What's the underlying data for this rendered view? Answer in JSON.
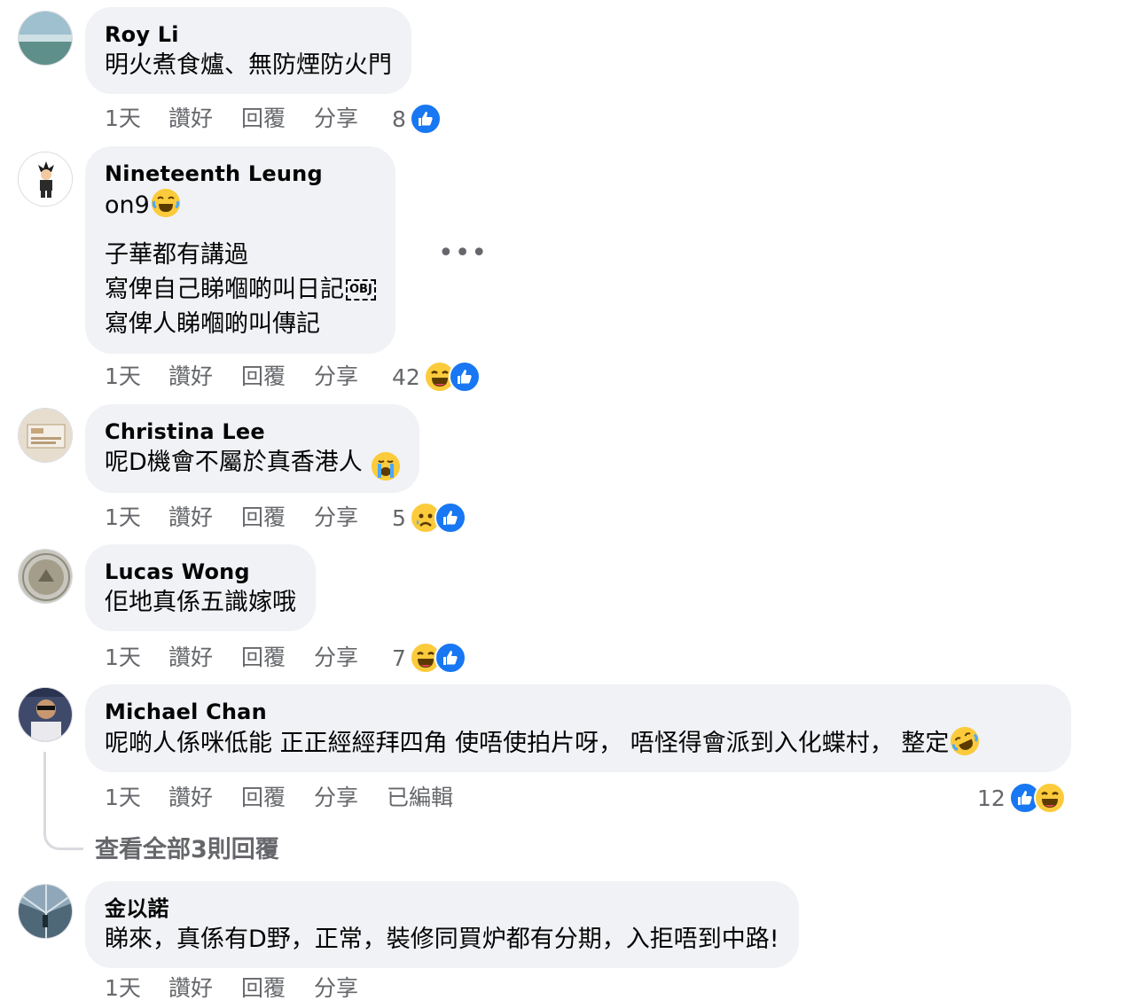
{
  "actions": {
    "time": "1天",
    "like": "讚好",
    "reply": "回覆",
    "share": "分享",
    "edited": "已編輯"
  },
  "comments": [
    {
      "name": "Roy Li",
      "lines": [
        "明火煮食爐、無防煙防火門"
      ],
      "reaction_count": "8",
      "reactions": [
        "like"
      ]
    },
    {
      "name": "Nineteenth Leung",
      "lines": [
        "on9",
        "子華都有講過",
        "寫俾自己睇嗰啲叫日記",
        "寫俾人睇嗰啲叫傳記"
      ],
      "obj_label": "OBJ",
      "reaction_count": "42",
      "reactions": [
        "haha",
        "like"
      ]
    },
    {
      "name": "Christina Lee",
      "lines": [
        "呢D機會不屬於真香港人"
      ],
      "reaction_count": "5",
      "reactions": [
        "sad",
        "like"
      ]
    },
    {
      "name": "Lucas Wong",
      "lines": [
        "佢地真係五識嫁哦"
      ],
      "reaction_count": "7",
      "reactions": [
        "haha",
        "like"
      ]
    },
    {
      "name": "Michael Chan",
      "lines": [
        "呢啲人係咪低能 正正經經拜四角 使唔使拍片呀， 唔怪得會派到入化蝶村， 整定"
      ],
      "reaction_count": "12",
      "reactions": [
        "like",
        "haha"
      ]
    },
    {
      "name": "金以諾",
      "lines": [
        "睇來，真係有D野，正常，裝修同買炉都有分期，入拒唔到中路!"
      ]
    }
  ],
  "view_replies": "查看全部3則回覆",
  "colors": {
    "bubble": "#f0f2f5",
    "meta": "#65676b",
    "like_blue": "#1877f2",
    "emoji_yellow": "#fbcb3c"
  }
}
